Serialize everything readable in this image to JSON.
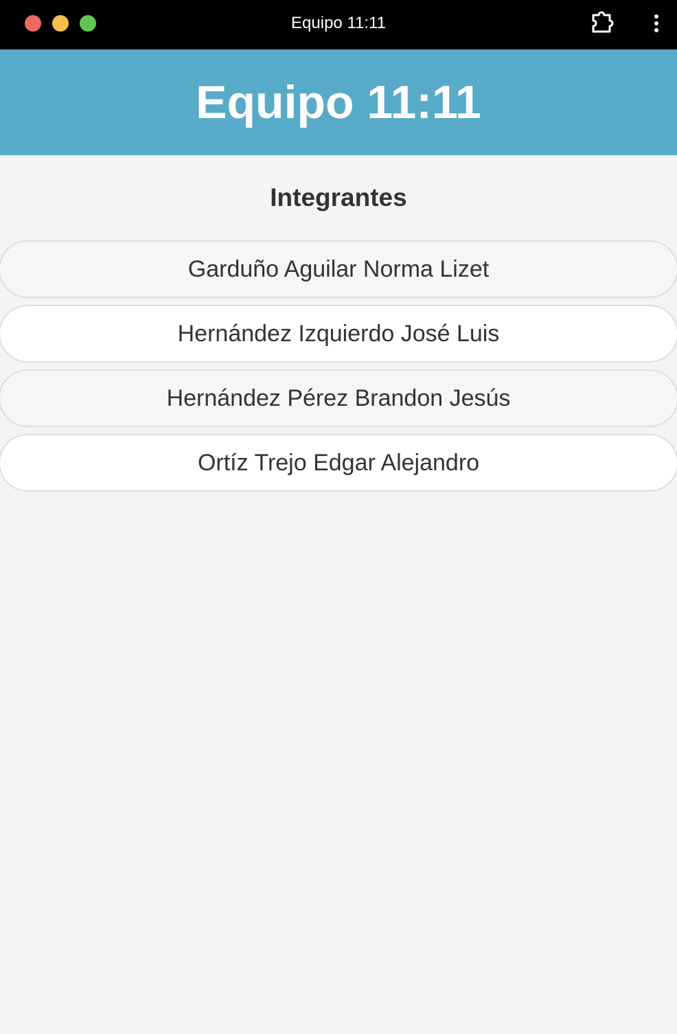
{
  "window": {
    "title": "Equipo 11:11",
    "icons": [
      "close-dot",
      "minimize-dot",
      "maximize-dot",
      "extension-icon",
      "more-vertical-icon"
    ]
  },
  "header": {
    "title": "Equipo 11:11",
    "background": "#58aac9"
  },
  "members": {
    "heading": "Integrantes",
    "items": [
      "Garduño Aguilar Norma Lizet",
      "Hernández Izquierdo José Luis",
      "Hernández Pérez Brandon Jesús",
      "Ortíz Trejo Edgar Alejandro"
    ]
  }
}
